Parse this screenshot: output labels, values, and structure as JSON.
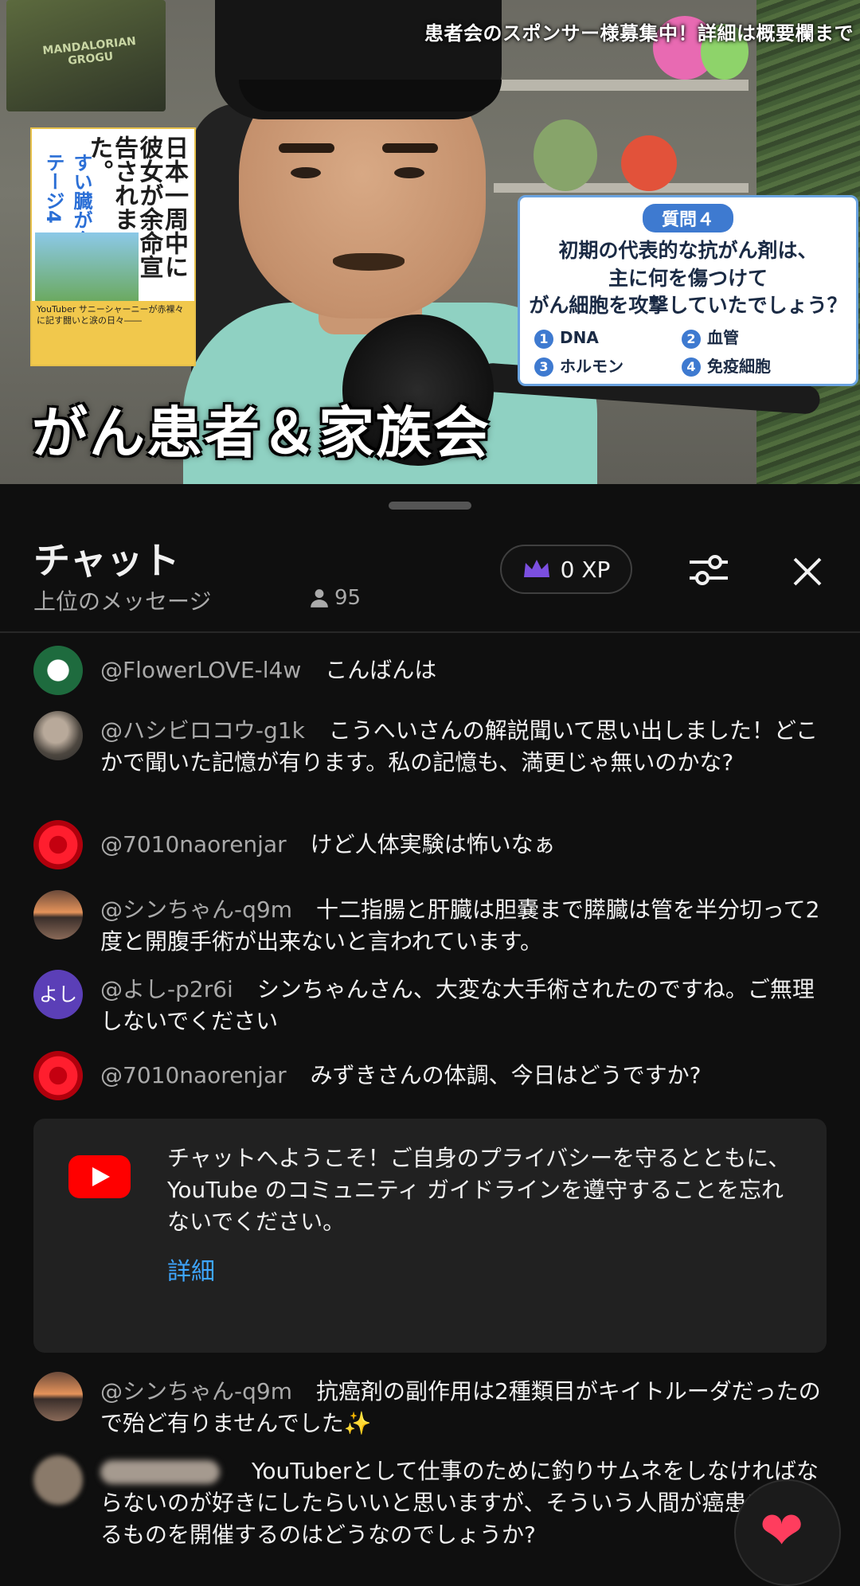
{
  "video": {
    "top_banner": "患者会のスポンサー様募集中！詳細は概要欄まで",
    "poster_text": "MANDALORIAN GROGU",
    "book": {
      "title": "日本一周中に彼女が余命宣告されました。",
      "subtitle": "すい臓がんステージ4",
      "band_text": "YouTuber サニーシャーニーが赤裸々に記す闘いと涙の日々――"
    },
    "quiz": {
      "badge": "質問４",
      "question_lines": [
        "初期の代表的な抗がん剤は、",
        "主に何を傷つけて",
        "がん細胞を攻撃していたでしょう？"
      ],
      "options": [
        {
          "num": "1",
          "label": "DNA"
        },
        {
          "num": "2",
          "label": "血管"
        },
        {
          "num": "3",
          "label": "ホルモン"
        },
        {
          "num": "4",
          "label": "免疫細胞"
        }
      ]
    },
    "overlay_title": "がん患者＆家族会"
  },
  "chat": {
    "title": "チャット",
    "mode": "上位のメッセージ",
    "viewer_count": "95",
    "xp_label": "0 XP",
    "accent_color": "#7b4fe0",
    "messages": [
      {
        "author": "@FlowerLOVE-l4w",
        "text": "こんばんは",
        "avatar": "starbucks-avatar"
      },
      {
        "author": "@ハシビロコウ-g1k",
        "text": "こうへいさんの解説聞いて思い出しました！どこかで聞いた記憶が有ります。私の記憶も、満更じゃ無いのかな?",
        "avatar": "bird-avatar"
      },
      {
        "author": "@7010naorenjar",
        "text": "けど人体実験は怖いなぁ",
        "avatar": "flower-avatar"
      },
      {
        "author": "@シンちゃん-q9m",
        "text": "十二指腸と肝臓は胆嚢まで膵臓は管を半分切って2度と開腹手術が出来ないと言われています。",
        "avatar": "sunset-avatar"
      },
      {
        "author": "@よし-p2r6i",
        "text": "シンちゃんさん、大変な大手術されたのですね。ご無理しないでください",
        "avatar_text": "よし"
      },
      {
        "author": "@7010naorenjar",
        "text": "みずきさんの体調、今日はどうですか?",
        "avatar": "flower-avatar"
      }
    ],
    "notice": {
      "text": "チャットへようこそ！ご自身のプライバシーを守るとともに、YouTube のコミュニティ ガイドラインを遵守することを忘れないでください。",
      "link": "詳細"
    },
    "messages_after": [
      {
        "author": "@シンちゃん-q9m",
        "text": "抗癌剤の副作用は2種類目がキイトルーダだったので殆ど有りませんでした✨",
        "avatar": "sunset-avatar"
      },
      {
        "author": "",
        "text": "YouTuberとして仕事のために釣りサムネをしなければならないのが好きにしたらいいと思いますが、そういう人間が癌患者会なるものを開催するのはどうなのでしょうか?",
        "avatar": "blurred-avatar"
      }
    ],
    "heart_icon": "heart-icon"
  }
}
